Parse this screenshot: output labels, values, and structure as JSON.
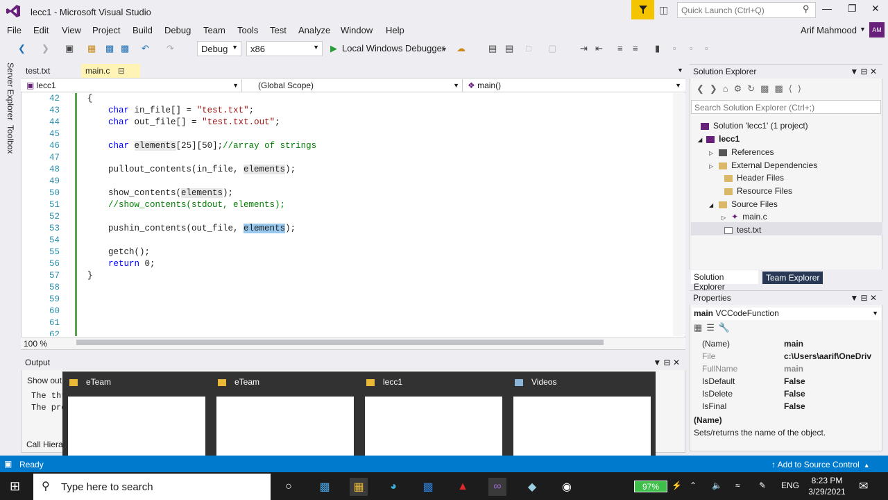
{
  "window": {
    "title": "lecc1 - Microsoft Visual Studio"
  },
  "quick_launch": {
    "placeholder": "Quick Launch (Ctrl+Q)"
  },
  "menu": [
    "File",
    "Edit",
    "View",
    "Project",
    "Build",
    "Debug",
    "Team",
    "Tools",
    "Test",
    "Analyze",
    "Window",
    "Help"
  ],
  "user": {
    "name": "Arif Mahmood",
    "initials": "AM"
  },
  "toolbar": {
    "config": "Debug",
    "platform": "x86",
    "debugger": "Local Windows Debugger"
  },
  "side_tabs": [
    "Server Explorer",
    "Toolbox"
  ],
  "tabs": [
    {
      "label": "test.txt"
    },
    {
      "label": "main.c"
    }
  ],
  "navbar": {
    "project": "lecc1",
    "scope": "(Global Scope)",
    "member": "main()"
  },
  "code_lines": [
    {
      "n": "42",
      "t": "{"
    },
    {
      "n": "43",
      "t": "    char in_file[] = \"test.txt\";"
    },
    {
      "n": "44",
      "t": "    char out_file[] = \"test.txt.out\";"
    },
    {
      "n": "45",
      "t": ""
    },
    {
      "n": "46",
      "t": "    char elements[25][50];//array of strings"
    },
    {
      "n": "47",
      "t": ""
    },
    {
      "n": "48",
      "t": "    pullout_contents(in_file, elements);"
    },
    {
      "n": "49",
      "t": ""
    },
    {
      "n": "50",
      "t": "    show_contents(elements);"
    },
    {
      "n": "51",
      "t": "    //show_contents(stdout, elements);"
    },
    {
      "n": "52",
      "t": ""
    },
    {
      "n": "53",
      "t": "    pushin_contents(out_file, elements);"
    },
    {
      "n": "54",
      "t": ""
    },
    {
      "n": "55",
      "t": "    getch();"
    },
    {
      "n": "56",
      "t": "    return 0;"
    },
    {
      "n": "57",
      "t": "}"
    },
    {
      "n": "58",
      "t": ""
    },
    {
      "n": "59",
      "t": ""
    },
    {
      "n": "60",
      "t": ""
    },
    {
      "n": "61",
      "t": ""
    },
    {
      "n": "62",
      "t": ""
    }
  ],
  "zoom": "100 %",
  "solution_explorer": {
    "title": "Solution Explorer",
    "search_placeholder": "Search Solution Explorer (Ctrl+;)",
    "solution": "Solution 'lecc1' (1 project)",
    "project": "lecc1",
    "items": [
      "References",
      "External Dependencies",
      "Header Files",
      "Resource Files",
      "Source Files",
      "main.c",
      "test.txt"
    ],
    "tab_active": "Solution Explorer",
    "tab_other": "Team Explorer"
  },
  "properties": {
    "title": "Properties",
    "object": "main",
    "object_type": "VCCodeFunction",
    "rows": [
      {
        "name": "(Name)",
        "value": "main"
      },
      {
        "name": "File",
        "value": "c:\\Users\\aarif\\OneDriv"
      },
      {
        "name": "FullName",
        "value": "main"
      },
      {
        "name": "IsDefault",
        "value": "False"
      },
      {
        "name": "IsDelete",
        "value": "False"
      },
      {
        "name": "IsFinal",
        "value": "False"
      }
    ],
    "desc_title": "(Name)",
    "desc_text": "Sets/returns the name of the object."
  },
  "output": {
    "title": "Output",
    "show_output": "Show out",
    "line1": "The thr",
    "line2": "The pro",
    "call_hier": "Call Hierar"
  },
  "thumbnails": [
    {
      "label": "eTeam"
    },
    {
      "label": "eTeam"
    },
    {
      "label": "lecc1"
    },
    {
      "label": "Videos"
    }
  ],
  "status": {
    "ready": "Ready",
    "source_control": "Add to Source Control"
  },
  "taskbar": {
    "search_placeholder": "Type here to search",
    "battery": "97%",
    "lang": "ENG",
    "time": "8:23 PM",
    "date": "3/29/2021"
  }
}
